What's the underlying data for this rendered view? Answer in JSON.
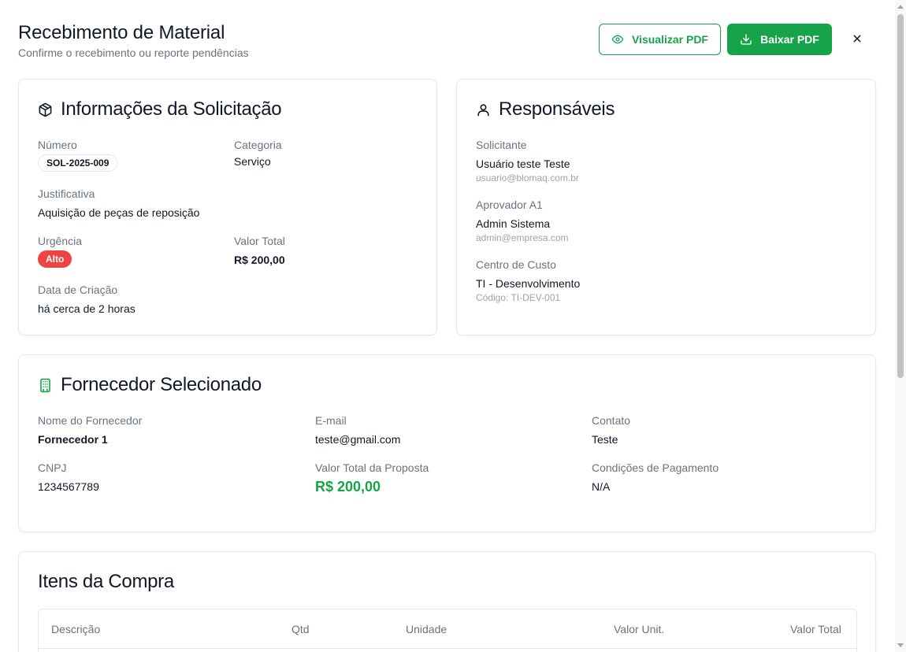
{
  "header": {
    "title": "Recebimento de Material",
    "subtitle": "Confirme o recebimento ou reporte pendências",
    "view_pdf": "Visualizar PDF",
    "download_pdf": "Baixar PDF"
  },
  "info": {
    "title": "Informações da Solicitação",
    "numero_label": "Número",
    "numero": "SOL-2025-009",
    "categoria_label": "Categoria",
    "categoria": "Serviço",
    "justificativa_label": "Justificativa",
    "justificativa": "Aquisição de peças de reposição",
    "urgencia_label": "Urgência",
    "urgencia": "Alto",
    "valor_label": "Valor Total",
    "valor": "R$ 200,00",
    "data_label": "Data de Criação",
    "data": "há cerca de 2 horas"
  },
  "responsaveis": {
    "title": "Responsáveis",
    "solicitante_label": "Solicitante",
    "solicitante": "Usuário teste Teste",
    "solicitante_email": "usuario@blomaq.com.br",
    "aprovador_label": "Aprovador A1",
    "aprovador": "Admin Sistema",
    "aprovador_email": "admin@empresa.com",
    "centro_label": "Centro de Custo",
    "centro": "TI - Desenvolvimento",
    "centro_codigo": "Código: TI-DEV-001"
  },
  "fornecedor": {
    "title": "Fornecedor Selecionado",
    "nome_label": "Nome do Fornecedor",
    "nome": "Fornecedor 1",
    "email_label": "E-mail",
    "email": "teste@gmail.com",
    "contato_label": "Contato",
    "contato": "Teste",
    "cnpj_label": "CNPJ",
    "cnpj": "1234567789",
    "proposta_label": "Valor Total da Proposta",
    "proposta": "R$ 200,00",
    "pagamento_label": "Condições de Pagamento",
    "pagamento": "N/A"
  },
  "itens": {
    "title": "Itens da Compra",
    "columns": [
      "Descrição",
      "Qtd",
      "Unidade",
      "Valor Unit.",
      "Valor Total"
    ]
  },
  "colors": {
    "accent": "#16a34a",
    "danger": "#ef4444"
  },
  "icons": [
    "eye-icon",
    "download-icon",
    "close-icon",
    "package-icon",
    "user-icon",
    "building-icon"
  ]
}
